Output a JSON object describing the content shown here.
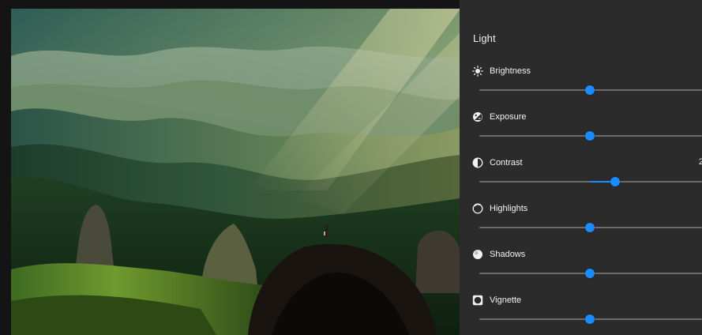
{
  "panel": {
    "heading": "Light",
    "accent_color": "#1a8cff",
    "adjustments": [
      {
        "id": "brightness",
        "label": "Brightness",
        "icon": "sun-icon",
        "value": 0,
        "value_text": "",
        "range": [
          -100,
          100
        ]
      },
      {
        "id": "exposure",
        "label": "Exposure",
        "icon": "exposure-icon",
        "value": 0,
        "value_text": "",
        "range": [
          -100,
          100
        ]
      },
      {
        "id": "contrast",
        "label": "Contrast",
        "icon": "contrast-icon",
        "value": 20,
        "value_text": "2",
        "range": [
          -100,
          100
        ]
      },
      {
        "id": "highlights",
        "label": "Highlights",
        "icon": "highlights-icon",
        "value": 0,
        "value_text": "",
        "range": [
          -100,
          100
        ]
      },
      {
        "id": "shadows",
        "label": "Shadows",
        "icon": "shadows-icon",
        "value": 0,
        "value_text": "",
        "range": [
          -100,
          100
        ]
      },
      {
        "id": "vignette",
        "label": "Vignette",
        "icon": "vignette-icon",
        "value": 0,
        "value_text": "",
        "range": [
          -100,
          100
        ]
      }
    ]
  }
}
